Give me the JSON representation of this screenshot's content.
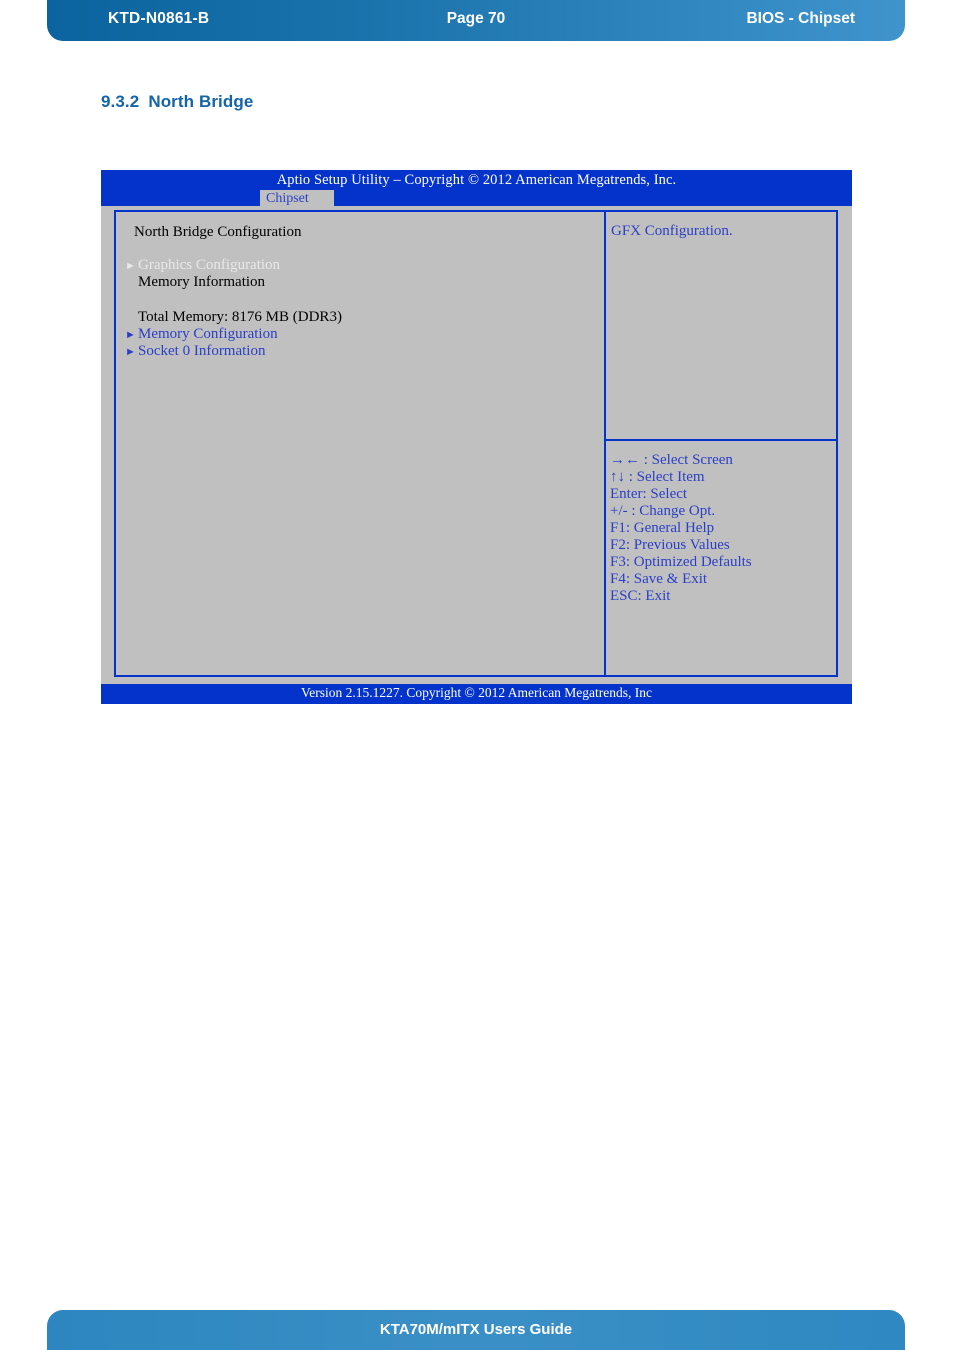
{
  "page_header": {
    "doc_code": "KTD-N0861-B",
    "page_label": "Page 70",
    "section_label": "BIOS  - Chipset"
  },
  "page_footer": {
    "guide_title": "KTA70M/mITX Users Guide"
  },
  "section": {
    "number": "9.3.2",
    "title": "North Bridge"
  },
  "bios": {
    "title": "Aptio Setup Utility  –  Copyright © 2012 American Megatrends, Inc.",
    "active_tab": "Chipset",
    "screen_heading": "North Bridge Configuration",
    "items": [
      {
        "arrow": "►",
        "label": "Graphics Configuration",
        "style": "white",
        "has_arrow": true
      },
      {
        "arrow": "",
        "label": "Memory Information",
        "style": "black",
        "has_arrow": false
      },
      {
        "arrow": "",
        "label": "",
        "style": "black",
        "has_arrow": false
      },
      {
        "arrow": "",
        "label": "Total Memory: 8176 MB (DDR3)",
        "style": "black",
        "has_arrow": false
      },
      {
        "arrow": "►",
        "label": "Memory Configuration",
        "style": "blue",
        "has_arrow": true
      },
      {
        "arrow": "►",
        "label": "Socket 0 Information",
        "style": "blue",
        "has_arrow": true
      }
    ],
    "help_text": "GFX Configuration.",
    "keys": [
      "→← : Select Screen",
      "↑↓ : Select Item",
      "Enter: Select",
      "+/- : Change Opt.",
      "F1: General Help",
      "F2: Previous Values",
      "F3: Optimized Defaults",
      "F4: Save & Exit",
      "ESC: Exit"
    ],
    "version": "Version 2.15.1227. Copyright © 2012 American Megatrends, Inc"
  },
  "colors": {
    "bios_blue": "#0433cc",
    "bios_gray": "#c0c0c0",
    "bios_text_blue": "#2b3fc4",
    "heading_blue": "#1365a8",
    "header_band": "#1a72ab",
    "footer_band": "#3a90c6"
  }
}
